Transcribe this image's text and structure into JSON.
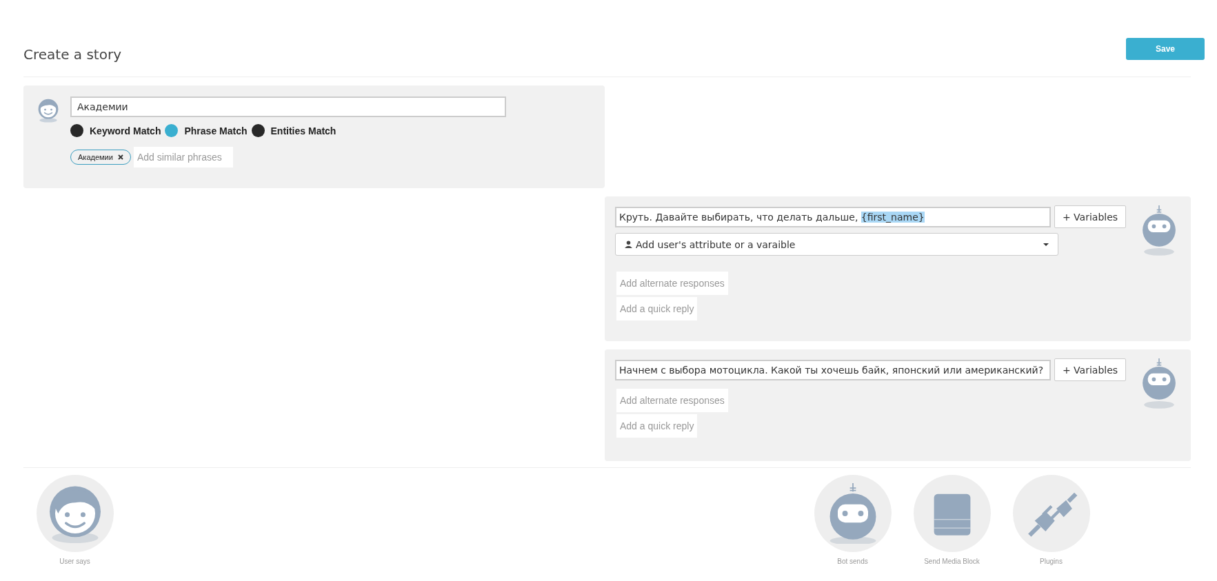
{
  "header": {
    "title": "Create a story",
    "save_button": "Save"
  },
  "user_says": {
    "phrase": "Академии",
    "match_options": [
      {
        "label": "Keyword Match",
        "selected": false
      },
      {
        "label": "Phrase Match",
        "selected": true
      },
      {
        "label": "Entities Match",
        "selected": false
      }
    ],
    "tags": [
      "Академии"
    ],
    "similar_placeholder": "Add similar phrases"
  },
  "bot_responses": [
    {
      "text": "Круть. Давайте выбирать, что делать дальше, ",
      "variable": "{first_name}",
      "variables_button": "+ Variables",
      "attribute_dropdown": "Add user's attribute or a varaible",
      "alternate": "Add alternate responses",
      "quick_reply": "Add a quick reply"
    },
    {
      "text": "Начнем с выбора мотоцикла. Какой ты хочешь байк, японский или американский?",
      "variables_button": "+ Variables",
      "alternate": "Add alternate responses",
      "quick_reply": "Add a quick reply"
    }
  ],
  "blocks": [
    {
      "kind": "user",
      "label": "User says"
    },
    {
      "kind": "bot",
      "label": "Bot sends"
    },
    {
      "kind": "media",
      "label": "Send Media Block"
    },
    {
      "kind": "plugin",
      "label": "Plugins"
    }
  ]
}
